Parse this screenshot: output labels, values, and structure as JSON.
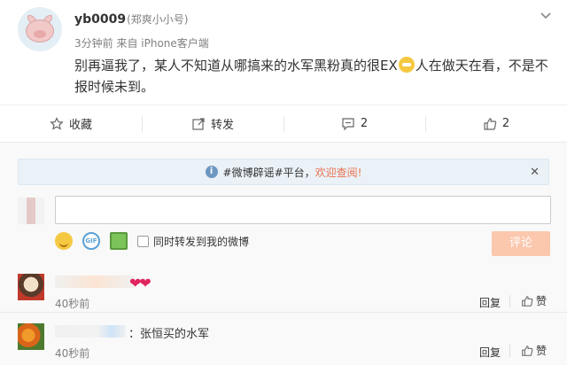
{
  "post": {
    "author": "yb0009",
    "remark": "(郑爽小小号)",
    "time": "3分钟前",
    "source": "来自 iPhone客户端",
    "text_before": "别再逼我了，某人不知道从哪搞来的水军黑粉真的很EX",
    "text_after": "人在做天在看，不是不报时候未到。"
  },
  "actions": {
    "favorite": "收藏",
    "repost": "转发",
    "comment_count": "2",
    "like_count": "2"
  },
  "comment_box": {
    "notice_prefix": "#微博辟谣#平台，",
    "notice_link": "欢迎查阅!",
    "repost_option": "同时转发到我的微博",
    "submit": "评论"
  },
  "comments": [
    {
      "text": "❤❤",
      "time": "40秒前",
      "reply": "回复",
      "like": "赞"
    },
    {
      "text": "：张恒买的水军",
      "time": "40秒前",
      "reply": "回复",
      "like": "赞"
    }
  ],
  "colors": {
    "accent": "#eb7350",
    "link": "#eb7350",
    "submit_disabled": "#fbc7ad"
  }
}
